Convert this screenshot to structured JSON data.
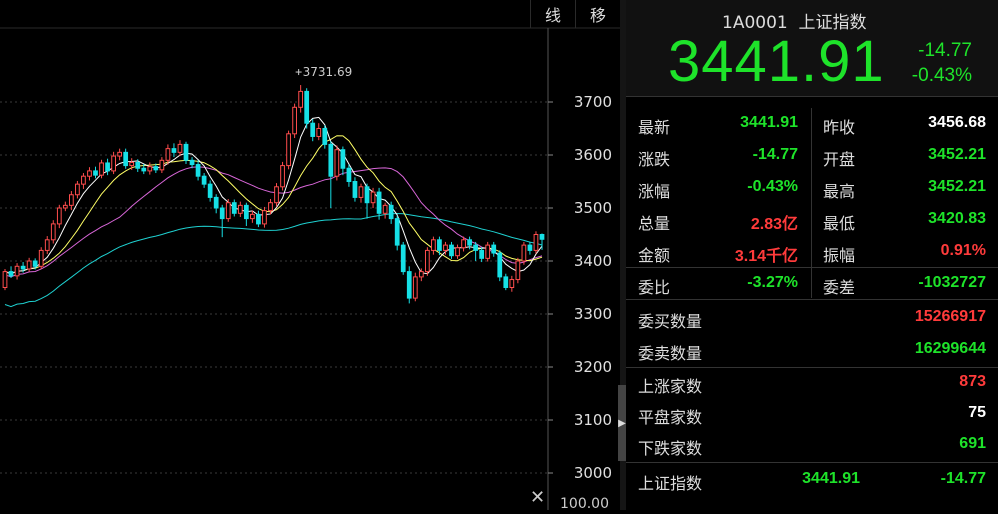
{
  "toolbar": {
    "line_label": "线",
    "move_label": "移"
  },
  "chart_data": {
    "type": "candlestick",
    "y_ticks": [
      3700,
      3600,
      3500,
      3400,
      3300,
      3200,
      3100,
      3000
    ],
    "ylim": [
      2975,
      3750
    ],
    "annotation": "3731.69",
    "colors": {
      "up": "#ff4d4d",
      "down": "#16e0e6",
      "ma5": "#ffffff",
      "ma10": "#ffff66",
      "ma20": "#d866d8",
      "ma60": "#1fd1d1"
    },
    "candles": [
      [
        3350,
        3380,
        3345,
        3385
      ],
      [
        3380,
        3372,
        3368,
        3390
      ],
      [
        3372,
        3390,
        3365,
        3396
      ],
      [
        3390,
        3385,
        3378,
        3398
      ],
      [
        3385,
        3400,
        3380,
        3406
      ],
      [
        3400,
        3390,
        3384,
        3405
      ],
      [
        3390,
        3420,
        3385,
        3426
      ],
      [
        3420,
        3440,
        3413,
        3447
      ],
      [
        3440,
        3470,
        3433,
        3477
      ],
      [
        3470,
        3500,
        3462,
        3506
      ],
      [
        3500,
        3505,
        3494,
        3512
      ],
      [
        3505,
        3525,
        3496,
        3532
      ],
      [
        3525,
        3545,
        3518,
        3551
      ],
      [
        3545,
        3560,
        3536,
        3566
      ],
      [
        3560,
        3570,
        3552,
        3577
      ],
      [
        3570,
        3562,
        3556,
        3578
      ],
      [
        3562,
        3585,
        3556,
        3591
      ],
      [
        3585,
        3570,
        3562,
        3593
      ],
      [
        3570,
        3598,
        3564,
        3606
      ],
      [
        3598,
        3605,
        3590,
        3612
      ],
      [
        3605,
        3580,
        3574,
        3612
      ],
      [
        3580,
        3586,
        3572,
        3594
      ],
      [
        3586,
        3575,
        3568,
        3592
      ],
      [
        3575,
        3570,
        3564,
        3583
      ],
      [
        3570,
        3578,
        3563,
        3586
      ],
      [
        3578,
        3572,
        3566,
        3584
      ],
      [
        3572,
        3590,
        3566,
        3596
      ],
      [
        3590,
        3612,
        3582,
        3620
      ],
      [
        3612,
        3605,
        3596,
        3622
      ],
      [
        3605,
        3620,
        3598,
        3628
      ],
      [
        3620,
        3590,
        3583,
        3625
      ],
      [
        3590,
        3582,
        3575,
        3596
      ],
      [
        3582,
        3560,
        3552,
        3590
      ],
      [
        3560,
        3545,
        3538,
        3566
      ],
      [
        3545,
        3520,
        3512,
        3552
      ],
      [
        3520,
        3500,
        3490,
        3526
      ],
      [
        3500,
        3480,
        3445,
        3506
      ],
      [
        3480,
        3510,
        3474,
        3517
      ],
      [
        3510,
        3490,
        3484,
        3516
      ],
      [
        3490,
        3505,
        3483,
        3512
      ],
      [
        3505,
        3480,
        3466,
        3510
      ],
      [
        3480,
        3488,
        3472,
        3495
      ],
      [
        3488,
        3470,
        3464,
        3495
      ],
      [
        3470,
        3495,
        3463,
        3502
      ],
      [
        3495,
        3510,
        3488,
        3517
      ],
      [
        3510,
        3540,
        3503,
        3547
      ],
      [
        3540,
        3580,
        3533,
        3587
      ],
      [
        3580,
        3640,
        3573,
        3646
      ],
      [
        3640,
        3690,
        3632,
        3697
      ],
      [
        3690,
        3720,
        3680,
        3732
      ],
      [
        3720,
        3660,
        3650,
        3726
      ],
      [
        3660,
        3635,
        3626,
        3668
      ],
      [
        3635,
        3650,
        3628,
        3660
      ],
      [
        3650,
        3620,
        3612,
        3656
      ],
      [
        3620,
        3560,
        3500,
        3626
      ],
      [
        3560,
        3610,
        3552,
        3618
      ],
      [
        3610,
        3575,
        3562,
        3616
      ],
      [
        3575,
        3550,
        3540,
        3582
      ],
      [
        3550,
        3520,
        3512,
        3558
      ],
      [
        3520,
        3540,
        3510,
        3546
      ],
      [
        3540,
        3510,
        3480,
        3546
      ],
      [
        3510,
        3530,
        3500,
        3538
      ],
      [
        3530,
        3490,
        3478,
        3538
      ],
      [
        3490,
        3505,
        3480,
        3510
      ],
      [
        3505,
        3480,
        3470,
        3512
      ],
      [
        3480,
        3430,
        3420,
        3486
      ],
      [
        3430,
        3380,
        3374,
        3436
      ],
      [
        3380,
        3330,
        3320,
        3390
      ],
      [
        3330,
        3370,
        3324,
        3378
      ],
      [
        3370,
        3380,
        3362,
        3386
      ],
      [
        3380,
        3420,
        3372,
        3426
      ],
      [
        3420,
        3440,
        3412,
        3446
      ],
      [
        3440,
        3420,
        3411,
        3446
      ],
      [
        3420,
        3430,
        3412,
        3436
      ],
      [
        3430,
        3410,
        3404,
        3436
      ],
      [
        3410,
        3425,
        3404,
        3431
      ],
      [
        3425,
        3440,
        3418,
        3446
      ],
      [
        3440,
        3430,
        3422,
        3446
      ],
      [
        3430,
        3420,
        3400,
        3436
      ],
      [
        3420,
        3405,
        3398,
        3426
      ],
      [
        3405,
        3430,
        3399,
        3436
      ],
      [
        3430,
        3415,
        3408,
        3436
      ],
      [
        3415,
        3370,
        3362,
        3420
      ],
      [
        3370,
        3350,
        3345,
        3376
      ],
      [
        3350,
        3365,
        3342,
        3372
      ],
      [
        3365,
        3400,
        3358,
        3406
      ],
      [
        3400,
        3430,
        3393,
        3436
      ],
      [
        3430,
        3420,
        3412,
        3436
      ],
      [
        3420,
        3450,
        3414,
        3456
      ],
      [
        3450,
        3441,
        3421,
        3452
      ]
    ]
  },
  "quote": {
    "code": "1A0001",
    "name": "上证指数",
    "price": "3441.91",
    "change": "-14.77",
    "change_pct": "-0.43%",
    "rows": [
      {
        "l1": "最新",
        "v1": "3441.91",
        "c1": "g",
        "l2": "昨收",
        "v2": "3456.68",
        "c2": "w"
      },
      {
        "l1": "涨跌",
        "v1": "-14.77",
        "c1": "g",
        "l2": "开盘",
        "v2": "3452.21",
        "c2": "g"
      },
      {
        "l1": "涨幅",
        "v1": "-0.43%",
        "c1": "g",
        "l2": "最高",
        "v2": "3452.21",
        "c2": "g"
      },
      {
        "l1": "总量",
        "v1": "2.83亿",
        "c1": "r",
        "l2": "最低",
        "v2": "3420.83",
        "c2": "g"
      },
      {
        "l1": "金额",
        "v1": "3.14千亿",
        "c1": "r",
        "l2": "振幅",
        "v2": "0.91%",
        "c2": "r"
      },
      {
        "l1": "委比",
        "v1": "-3.27%",
        "c1": "g",
        "l2": "委差",
        "v2": "-1032727",
        "c2": "g"
      }
    ],
    "buy_qty_label": "委买数量",
    "buy_qty": "15266917",
    "sell_qty_label": "委卖数量",
    "sell_qty": "16299644",
    "up_label": "上涨家数",
    "up_count": "873",
    "flat_label": "平盘家数",
    "flat_count": "75",
    "down_label": "下跌家数",
    "down_count": "691",
    "index_label": "上证指数",
    "index_price": "3441.91",
    "index_change": "-14.77"
  },
  "partial_volume": "100.00"
}
